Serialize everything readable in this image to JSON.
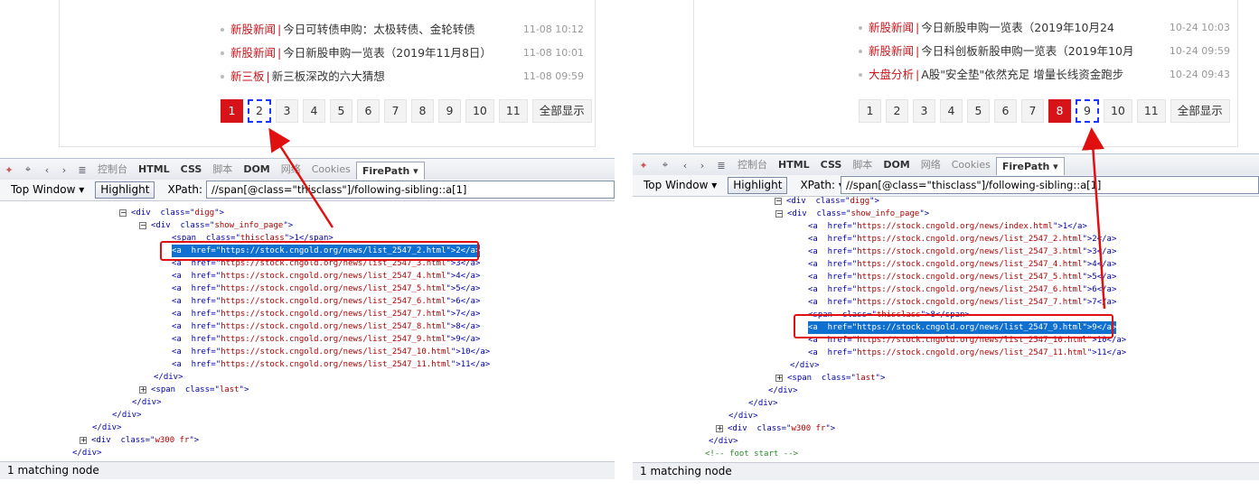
{
  "left": {
    "news": [
      {
        "category": "新股新闻",
        "sep": "|",
        "title": "今日可转债申购：太极转债、金轮转债",
        "date": "11-08 10:12"
      },
      {
        "category": "新股新闻",
        "sep": "|",
        "title": "今日新股申购一览表（2019年11月8日）",
        "date": "11-08 10:01"
      },
      {
        "category": "新三板",
        "sep": "|",
        "title": "新三板深改的六大猜想",
        "date": "11-08 09:59"
      }
    ],
    "pages": [
      "1",
      "2",
      "3",
      "4",
      "5",
      "6",
      "7",
      "8",
      "9",
      "10",
      "11",
      "全部显示"
    ],
    "toolbar": {
      "tabs": [
        "控制台",
        "HTML",
        "CSS",
        "脚本",
        "DOM",
        "网络",
        "Cookies",
        "FirePath"
      ],
      "window_btn": "Top Window",
      "highlight_btn": "Highlight",
      "xpath_label": "XPath:",
      "xpath_value": "//span[@class=\"thisclass\"]/following-sibling::a[1]"
    },
    "code": [
      {
        "pre": "<div  class=\"",
        "val": "digg",
        "post": "\">"
      },
      {
        "pre": "<div  class=\"",
        "val": "show_info_page",
        "post": "\">"
      },
      {
        "pre": "<span  class=\"",
        "val": "thisclass",
        "post": "\">1</span>"
      },
      {
        "pre": "<a  href=\"",
        "val": "https://stock.cngold.org/news/list_2547_2.html",
        "post": "\">2</a>"
      },
      {
        "pre": "<a  href=\"",
        "val": "https://stock.cngold.org/news/list_2547_3.html",
        "post": "\">3</a>"
      },
      {
        "pre": "<a  href=\"",
        "val": "https://stock.cngold.org/news/list_2547_4.html",
        "post": "\">4</a>"
      },
      {
        "pre": "<a  href=\"",
        "val": "https://stock.cngold.org/news/list_2547_5.html",
        "post": "\">5</a>"
      },
      {
        "pre": "<a  href=\"",
        "val": "https://stock.cngold.org/news/list_2547_6.html",
        "post": "\">6</a>"
      },
      {
        "pre": "<a  href=\"",
        "val": "https://stock.cngold.org/news/list_2547_7.html",
        "post": "\">7</a>"
      },
      {
        "pre": "<a  href=\"",
        "val": "https://stock.cngold.org/news/list_2547_8.html",
        "post": "\">8</a>"
      },
      {
        "pre": "<a  href=\"",
        "val": "https://stock.cngold.org/news/list_2547_9.html",
        "post": "\">9</a>"
      },
      {
        "pre": "<a  href=\"",
        "val": "https://stock.cngold.org/news/list_2547_10.html",
        "post": "\">10</a>"
      },
      {
        "pre": "<a  href=\"",
        "val": "https://stock.cngold.org/news/list_2547_11.html",
        "post": "\">11</a>"
      },
      {
        "pre": "</div>",
        "val": "",
        "post": ""
      },
      {
        "pre": "<span  class=\"",
        "val": "last",
        "post": "\">"
      },
      {
        "pre": "</div>",
        "val": "",
        "post": ""
      },
      {
        "pre": "</div>",
        "val": "",
        "post": ""
      },
      {
        "pre": "</div>",
        "val": "",
        "post": ""
      },
      {
        "pre": "<div  class=\"",
        "val": "w300 fr",
        "post": "\">"
      },
      {
        "pre": "</div>",
        "val": "",
        "post": ""
      }
    ],
    "status": "1 matching node"
  },
  "right": {
    "news": [
      {
        "category": "新股新闻",
        "sep": "|",
        "title": "今日新股申购一览表（2019年10月24",
        "date": "10-24 10:03"
      },
      {
        "category": "新股新闻",
        "sep": "|",
        "title": "今日科创板新股申购一览表（2019年10月",
        "date": "10-24 09:59"
      },
      {
        "category": "大盘分析",
        "sep": "|",
        "title": "A股\"安全垫\"依然充足 增量长线资金跑步",
        "date": "10-24 09:43"
      }
    ],
    "pages": [
      "1",
      "2",
      "3",
      "4",
      "5",
      "6",
      "7",
      "8",
      "9",
      "10",
      "11",
      "全部显示"
    ],
    "toolbar": {
      "tabs": [
        "控制台",
        "HTML",
        "CSS",
        "脚本",
        "DOM",
        "网络",
        "Cookies",
        "FirePath"
      ],
      "window_btn": "Top Window",
      "highlight_btn": "Highlight",
      "xpath_label": "XPath:",
      "xpath_value": "//span[@class=\"thisclass\"]/following-sibling::a[1]"
    },
    "code": [
      {
        "pre": "<div  class=\"",
        "val": "digg",
        "post": "\">"
      },
      {
        "pre": "<div  class=\"",
        "val": "show_info_page",
        "post": "\">"
      },
      {
        "pre": "<a  href=\"",
        "val": "https://stock.cngold.org/news/index.html",
        "post": "\">1</a>"
      },
      {
        "pre": "<a  href=\"",
        "val": "https://stock.cngold.org/news/list_2547_2.html",
        "post": "\">2</a>"
      },
      {
        "pre": "<a  href=\"",
        "val": "https://stock.cngold.org/news/list_2547_3.html",
        "post": "\">3</a>"
      },
      {
        "pre": "<a  href=\"",
        "val": "https://stock.cngold.org/news/list_2547_4.html",
        "post": "\">4</a>"
      },
      {
        "pre": "<a  href=\"",
        "val": "https://stock.cngold.org/news/list_2547_5.html",
        "post": "\">5</a>"
      },
      {
        "pre": "<a  href=\"",
        "val": "https://stock.cngold.org/news/list_2547_6.html",
        "post": "\">6</a>"
      },
      {
        "pre": "<a  href=\"",
        "val": "https://stock.cngold.org/news/list_2547_7.html",
        "post": "\">7</a>"
      },
      {
        "pre": "<span  class=\"",
        "val": "thisclass",
        "post": "\">8</span>"
      },
      {
        "pre": "<a  href=\"",
        "val": "https://stock.cngold.org/news/list_2547_9.html",
        "post": "\">9</a>"
      },
      {
        "pre": "<a  href=\"",
        "val": "https://stock.cngold.org/news/list_2547_10.html",
        "post": "\">10</a>"
      },
      {
        "pre": "<a  href=\"",
        "val": "https://stock.cngold.org/news/list_2547_11.html",
        "post": "\">11</a>"
      },
      {
        "pre": "</div>",
        "val": "",
        "post": ""
      },
      {
        "pre": "<span  class=\"",
        "val": "last",
        "post": "\">"
      },
      {
        "pre": "</div>",
        "val": "",
        "post": ""
      },
      {
        "pre": "</div>",
        "val": "",
        "post": ""
      },
      {
        "pre": "</div>",
        "val": "",
        "post": ""
      },
      {
        "pre": "<div  class=\"",
        "val": "w300 fr",
        "post": "\">"
      },
      {
        "pre": "</div>",
        "val": "",
        "post": ""
      },
      {
        "pre": "<!-- foot start -->",
        "val": "",
        "post": ""
      }
    ],
    "status": "1 matching node"
  },
  "colors": {
    "accent_red": "#d7131a",
    "highlight_blue": "#1070d0",
    "annotation_red": "#e01010",
    "dashed_blue": "#1a36ff"
  }
}
